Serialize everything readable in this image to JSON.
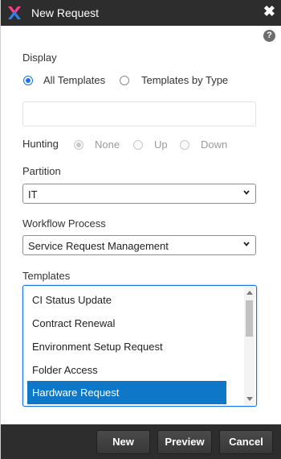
{
  "window": {
    "title": "New Request",
    "close_icon": "close-icon",
    "help_glyph": "?"
  },
  "display": {
    "label": "Display",
    "options": [
      {
        "label": "All Templates",
        "checked": true
      },
      {
        "label": "Templates by Type",
        "checked": false
      }
    ],
    "search_value": ""
  },
  "hunting": {
    "label": "Hunting",
    "options": [
      {
        "label": "None",
        "checked": true,
        "disabled": true
      },
      {
        "label": "Up",
        "checked": false,
        "disabled": true
      },
      {
        "label": "Down",
        "checked": false,
        "disabled": true
      }
    ]
  },
  "partition": {
    "label": "Partition",
    "value": "IT"
  },
  "workflow": {
    "label": "Workflow Process",
    "value": "Service Request Management"
  },
  "templates": {
    "label": "Templates",
    "items": [
      {
        "label": "CI Status Update",
        "selected": false
      },
      {
        "label": "Contract Renewal",
        "selected": false
      },
      {
        "label": "Environment Setup Request",
        "selected": false
      },
      {
        "label": "Folder Access",
        "selected": false
      },
      {
        "label": "Hardware Request",
        "selected": true
      }
    ]
  },
  "buttons": {
    "new": "New",
    "preview": "Preview",
    "cancel": "Cancel"
  },
  "colors": {
    "titlebar": "#2d2d2d",
    "accent": "#1a73e8",
    "selection": "#0f77c8"
  }
}
